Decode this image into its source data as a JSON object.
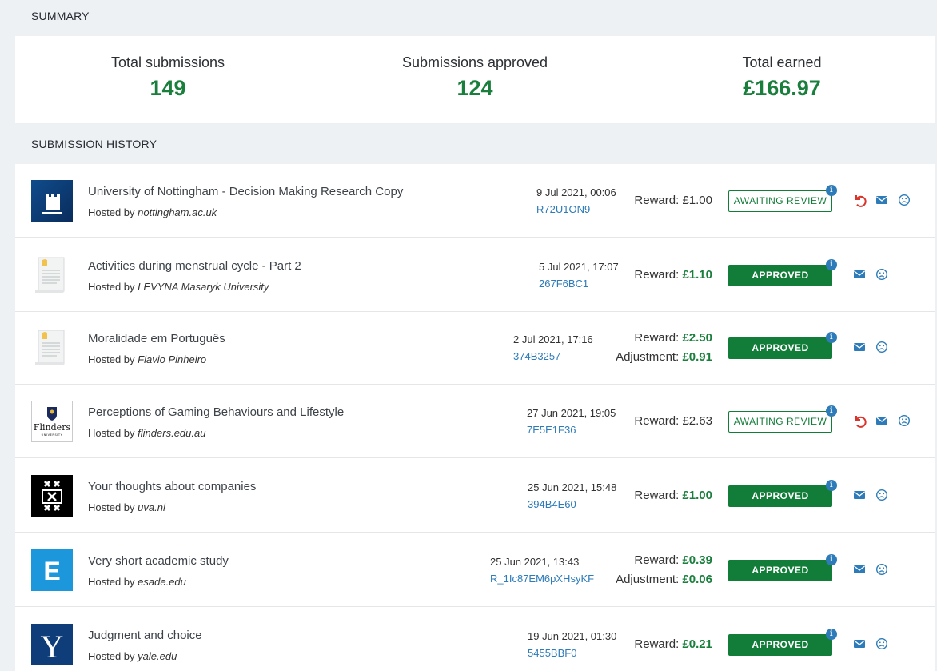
{
  "summary": {
    "heading": "SUMMARY",
    "stats": [
      {
        "label": "Total submissions",
        "value": "149"
      },
      {
        "label": "Submissions approved",
        "value": "124"
      },
      {
        "label": "Total earned",
        "value": "£166.97"
      }
    ]
  },
  "history": {
    "heading": "SUBMISSION HISTORY",
    "hosted_by_prefix": "Hosted by",
    "rows": [
      {
        "title": "University of Nottingham - Decision Making Research Copy",
        "host": "nottingham.ac.uk",
        "date": "9 Jul 2021, 00:06",
        "code": "R72U1ON9",
        "reward_label": "Reward:",
        "reward": "£1.00",
        "status": "AWAITING REVIEW",
        "logo": "nottingham-logo"
      },
      {
        "title": "Activities during menstrual cycle - Part 2",
        "host": "LEVYNA Masaryk University",
        "date": "5 Jul 2021, 17:07",
        "code": "267F6BC1",
        "reward_label": "Reward:",
        "reward": "£1.10",
        "status": "APPROVED",
        "logo": "document-placeholder-logo"
      },
      {
        "title": "Moralidade em Português",
        "host": "Flavio Pinheiro",
        "date": "2 Jul 2021, 17:16",
        "code": "374B3257",
        "reward_label": "Reward:",
        "reward": "£2.50",
        "adjustment_label": "Adjustment:",
        "adjustment": "£0.91",
        "status": "APPROVED",
        "logo": "document-placeholder-logo"
      },
      {
        "title": "Perceptions of Gaming Behaviours and Lifestyle",
        "host": "flinders.edu.au",
        "date": "27 Jun 2021, 19:05",
        "code": "7E5E1F36",
        "reward_label": "Reward:",
        "reward": "£2.63",
        "status": "AWAITING REVIEW",
        "logo": "flinders-logo",
        "logo_text": "Flinders"
      },
      {
        "title": "Your thoughts about companies",
        "host": "uva.nl",
        "date": "25 Jun 2021, 15:48",
        "code": "394B4E60",
        "reward_label": "Reward:",
        "reward": "£1.00",
        "status": "APPROVED",
        "logo": "uva-logo"
      },
      {
        "title": "Very short academic study",
        "host": "esade.edu",
        "date": "25 Jun 2021, 13:43",
        "code": "R_1Ic87EM6pXHsyKF",
        "reward_label": "Reward:",
        "reward": "£0.39",
        "adjustment_label": "Adjustment:",
        "adjustment": "£0.06",
        "status": "APPROVED",
        "logo": "esade-logo",
        "logo_text": "E"
      },
      {
        "title": "Judgment and choice",
        "host": "yale.edu",
        "date": "19 Jun 2021, 01:30",
        "code": "5455BBF0",
        "reward_label": "Reward:",
        "reward": "£0.21",
        "status": "APPROVED",
        "logo": "yale-logo",
        "logo_text": "Y"
      }
    ]
  },
  "colors": {
    "accent_green": "#127d38",
    "link_blue": "#2d7bb8",
    "return_red": "#d9352c"
  },
  "icons": {
    "info": "info-icon",
    "return": "return-icon",
    "message": "envelope-icon",
    "feedback": "sad-face-icon"
  }
}
